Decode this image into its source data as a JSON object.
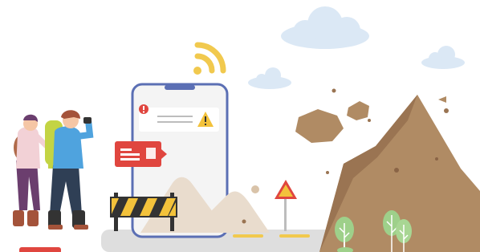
{
  "colors": {
    "sky_cloud": "#dbe8f5",
    "wifi": "#f1c94e",
    "phone_frame": "#5b6fb4",
    "phone_screen": "#f4f4f4",
    "alert_red": "#e0463f",
    "warning_yellow": "#f3c23b",
    "rock": "#b08b64",
    "rock_dark": "#9a7452",
    "barrier_stripe": "#f3c23b",
    "road": "#dedede",
    "road_line": "#f1c94e",
    "tree": "#9ed08a",
    "hiker_jacket": "#4fa3de",
    "hiker_backpack": "#c3d444"
  },
  "icons": {
    "wifi": "wifi-signal-icon",
    "alert": "exclamation-icon",
    "warning": "warning-triangle-icon",
    "message": "message-card-icon"
  }
}
